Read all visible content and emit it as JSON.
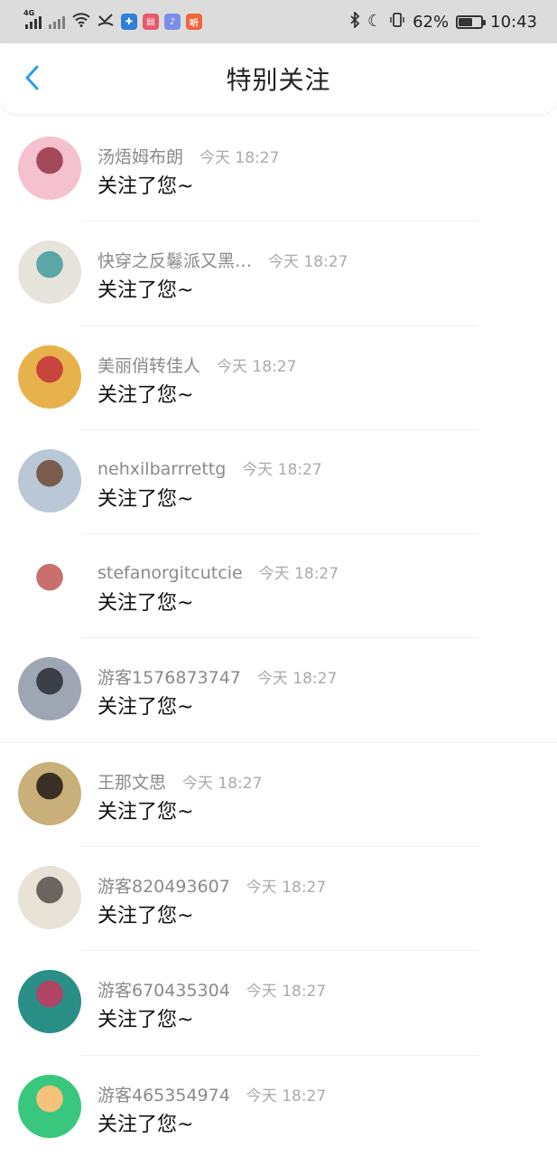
{
  "status_bar": {
    "network": "4G",
    "battery_pct": "62%",
    "battery_level": 0.62,
    "time": "10:43",
    "app_icons": [
      {
        "name": "shield-app-icon",
        "color": "#2f7fd6",
        "glyph": "✚"
      },
      {
        "name": "book-app-icon",
        "color": "#e8596b",
        "glyph": "▤"
      },
      {
        "name": "music-app-icon",
        "color": "#7b8fe8",
        "glyph": "♪"
      },
      {
        "name": "listen-app-icon",
        "color": "#f0663a",
        "glyph": "听"
      }
    ]
  },
  "header": {
    "title": "特别关注"
  },
  "items": [
    {
      "name": "汤焐姆布朗",
      "time": "今天 18:27",
      "message": "关注了您~",
      "avatar_colors": [
        "#f6c1cf",
        "#a34a5a"
      ]
    },
    {
      "name": "快穿之反鬈派又黑…",
      "time": "今天 18:27",
      "message": "关注了您~",
      "avatar_colors": [
        "#e7e4dc",
        "#5aa7a6"
      ]
    },
    {
      "name": "美丽俏转佳人",
      "time": "今天 18:27",
      "message": "关注了您~",
      "avatar_colors": [
        "#e7b24c",
        "#c8453d"
      ]
    },
    {
      "name": "nehxilbarrrettg",
      "time": "今天 18:27",
      "message": "关注了您~",
      "avatar_colors": [
        "#b9c7d6",
        "#7a5c4e"
      ]
    },
    {
      "name": "stefanorgitcutcie",
      "time": "今天 18:27",
      "message": "关注了您~",
      "avatar_colors": [
        "#ffffff",
        "#c9706f"
      ]
    },
    {
      "name": "游客1576873747",
      "time": "今天 18:27",
      "message": "关注了您~",
      "avatar_colors": [
        "#9ea6b4",
        "#3b3f48"
      ]
    },
    {
      "name": "王那文思",
      "time": "今天 18:27",
      "message": "关注了您~",
      "avatar_colors": [
        "#c9b07a",
        "#3a2f24"
      ]
    },
    {
      "name": "游客820493607",
      "time": "今天 18:27",
      "message": "关注了您~",
      "avatar_colors": [
        "#e9e2d6",
        "#6b6560"
      ]
    },
    {
      "name": "游客670435304",
      "time": "今天 18:27",
      "message": "关注了您~",
      "avatar_colors": [
        "#2a8f86",
        "#b04464"
      ]
    },
    {
      "name": "游客465354974",
      "time": "今天 18:27",
      "message": "关注了您~",
      "avatar_colors": [
        "#39c77d",
        "#f4c27a"
      ]
    }
  ]
}
